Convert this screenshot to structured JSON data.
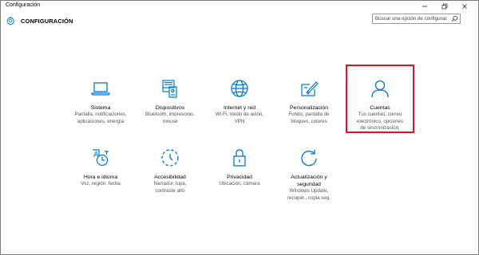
{
  "window": {
    "title": "Configuración",
    "minimize": "minimize-icon",
    "maximize": "maximize-icon",
    "close": "close-icon"
  },
  "header": {
    "icon": "gear-icon",
    "title": "CONFIGURACIÓN",
    "search_placeholder": "Buscar una opción de configuración",
    "search_icon": "search-icon"
  },
  "accent_color": "#0078d7",
  "highlight_color": "#e0141e",
  "tiles": [
    {
      "id": "sistema",
      "icon": "laptop-icon",
      "label": "Sistema",
      "desc": [
        "Pantalla, notificaciones,",
        "aplicaciones, energía"
      ]
    },
    {
      "id": "dispositivos",
      "icon": "devices-icon",
      "label": "Dispositivos",
      "desc": [
        "Bluetooth, impresoras,",
        "mouse"
      ]
    },
    {
      "id": "internet",
      "icon": "globe-icon",
      "label": "Internet y red",
      "desc": [
        "Wi-Fi, modo de avión,",
        "VPN"
      ]
    },
    {
      "id": "personalizacion",
      "icon": "paint-icon",
      "label": "Personalización",
      "desc": [
        "Fondo, pantalla de",
        "bloqueo, colores"
      ]
    },
    {
      "id": "cuentas",
      "icon": "person-icon",
      "label": "Cuentas",
      "desc": [
        "Tus cuentas, correo",
        "electrónico, opciones",
        "de sincronización,"
      ]
    },
    {
      "id": "hora",
      "icon": "time-language-icon",
      "label": "Hora e idioma",
      "desc": [
        "Voz, región, fecha"
      ]
    },
    {
      "id": "accesibilidad",
      "icon": "accessibility-icon",
      "label": "Accesibilidad",
      "desc": [
        "Narrador, lupa,",
        "contraste alto"
      ]
    },
    {
      "id": "privacidad",
      "icon": "lock-icon",
      "label": "Privacidad",
      "desc": [
        "Ubicación, cámara"
      ]
    },
    {
      "id": "actualizacion",
      "icon": "update-icon",
      "label": "Actualización y seguridad",
      "label_lines": [
        "Actualización y",
        "seguridad"
      ],
      "desc": [
        "Windows Update,",
        "recuper., copia seg."
      ]
    }
  ]
}
